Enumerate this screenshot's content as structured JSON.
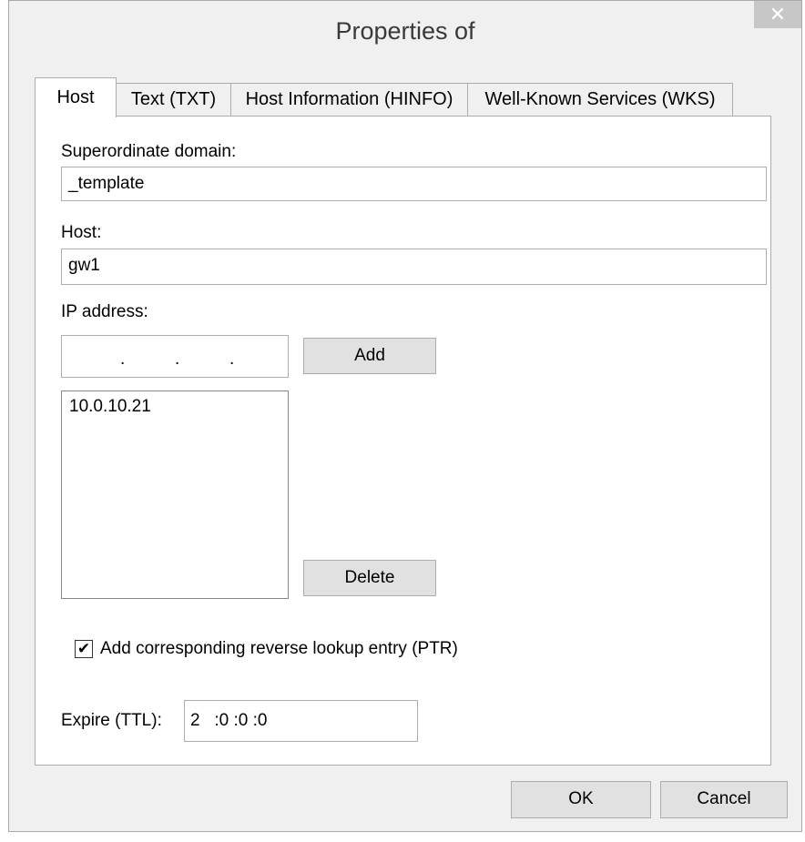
{
  "window": {
    "title": "Properties of",
    "close_glyph": "✕"
  },
  "tabs": [
    {
      "label": "Host",
      "active": true
    },
    {
      "label": "Text (TXT)",
      "active": false
    },
    {
      "label": "Host Information (HINFO)",
      "active": false
    },
    {
      "label": "Well-Known Services (WKS)",
      "active": false
    }
  ],
  "form": {
    "superordinate_domain_label": "Superordinate domain:",
    "superordinate_domain_value": "_template",
    "host_label": "Host:",
    "host_value": "gw1",
    "ip_address_label": "IP address:",
    "ip_input_separator": ".",
    "add_button": "Add",
    "ip_list": [
      "10.0.10.21"
    ],
    "delete_button": "Delete",
    "reverse_lookup_checked": true,
    "reverse_lookup_check_glyph": "✔",
    "reverse_lookup_label": "Add corresponding reverse lookup entry (PTR)",
    "expire_label": "Expire (TTL):",
    "expire_value": "2   :0 :0 :0"
  },
  "footer": {
    "ok_button": "OK",
    "cancel_button": "Cancel"
  }
}
